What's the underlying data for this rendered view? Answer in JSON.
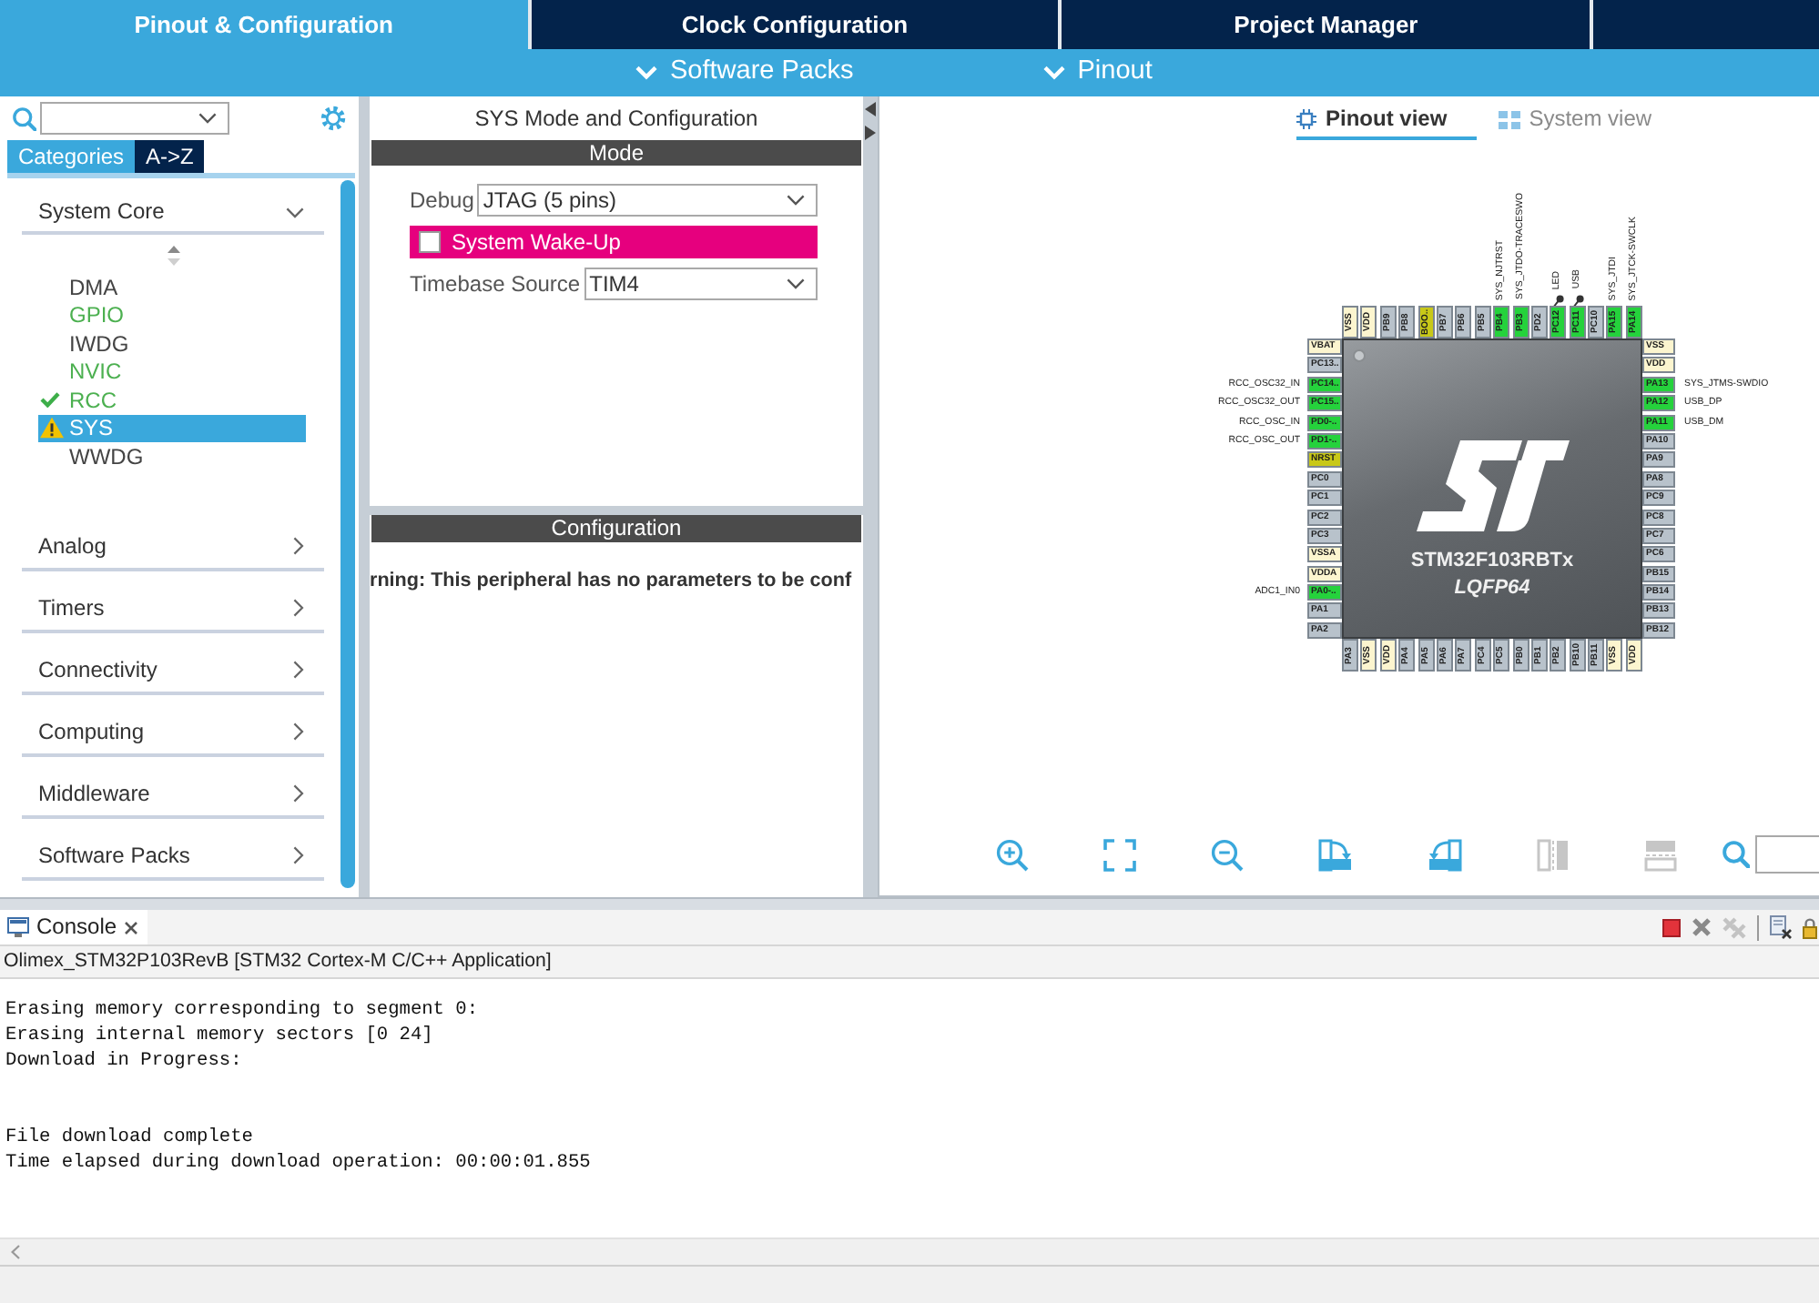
{
  "tabs": [
    {
      "label": "Pinout & Configuration",
      "selected": true
    },
    {
      "label": "Clock Configuration",
      "selected": false
    },
    {
      "label": "Project Manager",
      "selected": false
    }
  ],
  "menus": [
    {
      "label": "Software Packs"
    },
    {
      "label": "Pinout"
    }
  ],
  "sidebar": {
    "tabs": [
      {
        "label": "Categories",
        "selected": true
      },
      {
        "label": "A->Z",
        "selected": false
      }
    ],
    "categories": [
      {
        "label": "System Core",
        "expanded": true,
        "children": [
          {
            "label": "DMA",
            "kind": "plain",
            "selected": false
          },
          {
            "label": "GPIO",
            "kind": "configured",
            "selected": false
          },
          {
            "label": "IWDG",
            "kind": "plain",
            "selected": false
          },
          {
            "label": "NVIC",
            "kind": "configured",
            "selected": false
          },
          {
            "label": "RCC",
            "kind": "ok",
            "selected": false
          },
          {
            "label": "SYS",
            "kind": "warning",
            "selected": true
          },
          {
            "label": "WWDG",
            "kind": "plain",
            "selected": false
          }
        ]
      },
      {
        "label": "Analog",
        "expanded": false
      },
      {
        "label": "Timers",
        "expanded": false
      },
      {
        "label": "Connectivity",
        "expanded": false
      },
      {
        "label": "Computing",
        "expanded": false
      },
      {
        "label": "Middleware",
        "expanded": false
      },
      {
        "label": "Software Packs",
        "expanded": false
      }
    ]
  },
  "mode_panel": {
    "title": "SYS Mode and Configuration",
    "mode_header": "Mode",
    "fields": [
      {
        "kind": "select",
        "label": "Debug",
        "value": "JTAG (5 pins)"
      },
      {
        "kind": "checkbox",
        "label": "System Wake-Up",
        "checked": false,
        "conflict": true
      },
      {
        "kind": "select",
        "label": "Timebase Source",
        "value": "TIM4"
      }
    ],
    "config_header": "Configuration",
    "message": "rning: This peripheral has no parameters to be conf"
  },
  "pinout": {
    "view_tabs": [
      {
        "kind": "pinout",
        "label": "Pinout view",
        "selected": true
      },
      {
        "kind": "system",
        "label": "System view",
        "selected": false
      }
    ],
    "chip": {
      "part": "STM32F103RBTx",
      "package": "LQFP64",
      "pins": {
        "top": [
          {
            "name": "VSS",
            "kind": "power",
            "pinned": false
          },
          {
            "name": "VDD",
            "kind": "power",
            "pinned": false
          },
          {
            "name": "PB9",
            "kind": "io",
            "pinned": false
          },
          {
            "name": "PB8",
            "kind": "io",
            "pinned": false
          },
          {
            "name": "BOO..",
            "kind": "special",
            "pinned": false
          },
          {
            "name": "PB7",
            "kind": "io",
            "pinned": false
          },
          {
            "name": "PB6",
            "kind": "io",
            "pinned": false
          },
          {
            "name": "PB5",
            "kind": "io",
            "pinned": false
          },
          {
            "name": "PB4",
            "kind": "used",
            "signal": "SYS_NJTRST",
            "pinned": false
          },
          {
            "name": "PB3",
            "kind": "used",
            "signal": "SYS_JTDO-TRACESWO",
            "pinned": false
          },
          {
            "name": "PD2",
            "kind": "io",
            "pinned": false
          },
          {
            "name": "PC12",
            "kind": "used",
            "signal": "LED",
            "pinned": true
          },
          {
            "name": "PC11",
            "kind": "used",
            "signal": "USB",
            "pinned": true
          },
          {
            "name": "PC10",
            "kind": "io",
            "pinned": false
          },
          {
            "name": "PA15",
            "kind": "used",
            "signal": "SYS_JTDI",
            "pinned": false
          },
          {
            "name": "PA14",
            "kind": "used",
            "signal": "SYS_JTCK-SWCLK",
            "pinned": false
          }
        ],
        "left": [
          {
            "name": "VBAT",
            "kind": "power"
          },
          {
            "name": "PC13..",
            "kind": "io"
          },
          {
            "name": "PC14..",
            "kind": "used",
            "signal": "RCC_OSC32_IN"
          },
          {
            "name": "PC15..",
            "kind": "used",
            "signal": "RCC_OSC32_OUT"
          },
          {
            "name": "PD0-..",
            "kind": "used",
            "signal": "RCC_OSC_IN"
          },
          {
            "name": "PD1-..",
            "kind": "used",
            "signal": "RCC_OSC_OUT"
          },
          {
            "name": "NRST",
            "kind": "special"
          },
          {
            "name": "PC0",
            "kind": "io"
          },
          {
            "name": "PC1",
            "kind": "io"
          },
          {
            "name": "PC2",
            "kind": "io"
          },
          {
            "name": "PC3",
            "kind": "io"
          },
          {
            "name": "VSSA",
            "kind": "power"
          },
          {
            "name": "VDDA",
            "kind": "power"
          },
          {
            "name": "PA0-..",
            "kind": "used",
            "signal": "ADC1_IN0"
          },
          {
            "name": "PA1",
            "kind": "io"
          },
          {
            "name": "PA2",
            "kind": "io"
          }
        ],
        "right": [
          {
            "name": "VSS",
            "kind": "power"
          },
          {
            "name": "VDD",
            "kind": "power"
          },
          {
            "name": "PA13",
            "kind": "used",
            "signal": "SYS_JTMS-SWDIO"
          },
          {
            "name": "PA12",
            "kind": "used",
            "signal": "USB_DP"
          },
          {
            "name": "PA11",
            "kind": "used",
            "signal": "USB_DM"
          },
          {
            "name": "PA10",
            "kind": "io"
          },
          {
            "name": "PA9",
            "kind": "io"
          },
          {
            "name": "PA8",
            "kind": "io"
          },
          {
            "name": "PC9",
            "kind": "io"
          },
          {
            "name": "PC8",
            "kind": "io"
          },
          {
            "name": "PC7",
            "kind": "io"
          },
          {
            "name": "PC6",
            "kind": "io"
          },
          {
            "name": "PB15",
            "kind": "io"
          },
          {
            "name": "PB14",
            "kind": "io"
          },
          {
            "name": "PB13",
            "kind": "io"
          },
          {
            "name": "PB12",
            "kind": "io"
          }
        ],
        "bottom": [
          {
            "name": "PA3",
            "kind": "io"
          },
          {
            "name": "VSS",
            "kind": "power"
          },
          {
            "name": "VDD",
            "kind": "power"
          },
          {
            "name": "PA4",
            "kind": "io"
          },
          {
            "name": "PA5",
            "kind": "io"
          },
          {
            "name": "PA6",
            "kind": "io"
          },
          {
            "name": "PA7",
            "kind": "io"
          },
          {
            "name": "PC4",
            "kind": "io"
          },
          {
            "name": "PC5",
            "kind": "io"
          },
          {
            "name": "PB0",
            "kind": "io"
          },
          {
            "name": "PB1",
            "kind": "io"
          },
          {
            "name": "PB2",
            "kind": "io"
          },
          {
            "name": "PB10",
            "kind": "io"
          },
          {
            "name": "PB11",
            "kind": "io"
          },
          {
            "name": "VSS",
            "kind": "power"
          },
          {
            "name": "VDD",
            "kind": "power"
          }
        ]
      }
    },
    "toolbar": [
      {
        "kind": "zoom_in",
        "disabled": false
      },
      {
        "kind": "fit",
        "disabled": false
      },
      {
        "kind": "zoom_out",
        "disabled": false
      },
      {
        "kind": "rotate_right",
        "disabled": false
      },
      {
        "kind": "rotate_left",
        "disabled": false
      },
      {
        "kind": "split_vertical",
        "disabled": true
      },
      {
        "kind": "split_horizontal",
        "disabled": true
      }
    ]
  },
  "console": {
    "tab": "Console",
    "toolbar": [
      {
        "kind": "terminate",
        "disabled": false
      },
      {
        "kind": "remove",
        "disabled": false
      },
      {
        "kind": "remove_all",
        "disabled": true
      },
      {
        "kind": "clear",
        "disabled": false
      },
      {
        "kind": "scroll_lock",
        "disabled": false
      }
    ],
    "launch": "Olimex_STM32P103RevB [STM32 Cortex-M C/C++ Application]",
    "blocks": [
      [
        "Erasing memory corresponding to segment 0:",
        "Erasing internal memory sectors [0 24]",
        "Download in Progress:"
      ],
      [
        "File download complete",
        "Time elapsed during download operation: 00:00:01.855"
      ]
    ]
  }
}
